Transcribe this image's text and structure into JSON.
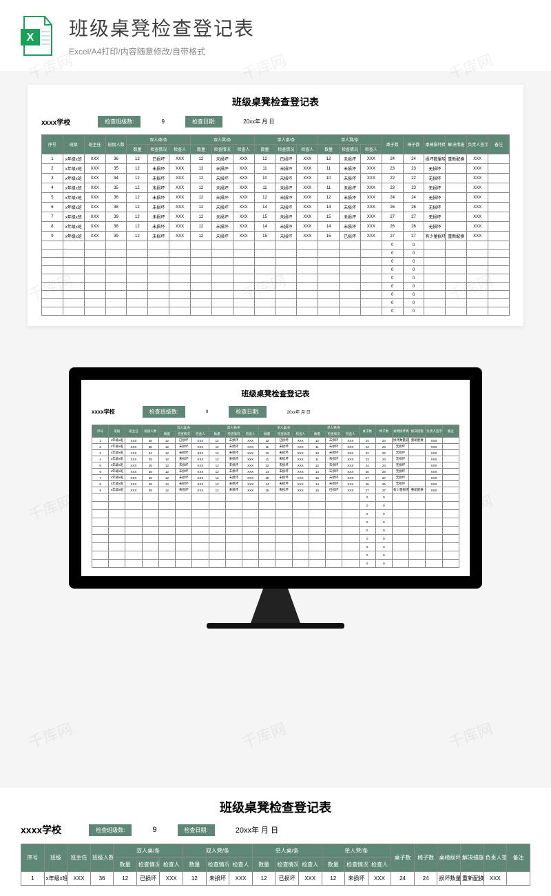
{
  "header": {
    "title": "班级桌凳检查登记表",
    "subtitle": "Excel/A4打印/内容随意修改/自带格式"
  },
  "doc": {
    "title": "班级桌凳检查登记表",
    "school": "xxxx学校",
    "check_class_label": "检查班级数:",
    "check_class_value": "9",
    "check_date_label": "检查日期:",
    "check_date_value": "20xx年 月 日"
  },
  "columns": {
    "seq": "序号",
    "class": "班级",
    "teacher": "班主任",
    "students": "班级人数",
    "g1": "双人桌/条",
    "g2": "双人凳/条",
    "g3": "单人桌/条",
    "g4": "单人凳/条",
    "qty": "数量",
    "status": "检查情况",
    "checker": "检查人",
    "desks": "桌子数",
    "chairs": "椅子数",
    "damage": "桌椅损坏情况",
    "solution": "解决措施",
    "sign": "负责人签字",
    "remark": "备注"
  },
  "rows": [
    {
      "seq": "1",
      "class": "x年级x班",
      "teacher": "XXX",
      "students": "36",
      "q1": "12",
      "s1": "已损坏",
      "c1": "XXX",
      "q2": "12",
      "s2": "未损坏",
      "c2": "XXX",
      "q3": "12",
      "s3": "已损坏",
      "c3": "XXX",
      "q4": "12",
      "s4": "未损坏",
      "c4": "XXX",
      "desks": "24",
      "chairs": "24",
      "damage": "损坏数量较少",
      "solution": "重新配换",
      "sign": "XXX",
      "remark": ""
    },
    {
      "seq": "2",
      "class": "x年级x班",
      "teacher": "XXX",
      "students": "35",
      "q1": "12",
      "s1": "未损坏",
      "c1": "XXX",
      "q2": "12",
      "s2": "未损坏",
      "c2": "XXX",
      "q3": "11",
      "s3": "未损坏",
      "c3": "XXX",
      "q4": "11",
      "s4": "未损坏",
      "c4": "XXX",
      "desks": "23",
      "chairs": "23",
      "damage": "无损坏",
      "solution": "",
      "sign": "XXX",
      "remark": ""
    },
    {
      "seq": "3",
      "class": "x年级x班",
      "teacher": "XXX",
      "students": "34",
      "q1": "12",
      "s1": "未损坏",
      "c1": "XXX",
      "q2": "12",
      "s2": "未损坏",
      "c2": "XXX",
      "q3": "10",
      "s3": "未损坏",
      "c3": "XXX",
      "q4": "10",
      "s4": "未损坏",
      "c4": "XXX",
      "desks": "22",
      "chairs": "22",
      "damage": "无损坏",
      "solution": "",
      "sign": "XXX",
      "remark": ""
    },
    {
      "seq": "4",
      "class": "x年级x班",
      "teacher": "XXX",
      "students": "35",
      "q1": "12",
      "s1": "未损坏",
      "c1": "XXX",
      "q2": "12",
      "s2": "未损坏",
      "c2": "XXX",
      "q3": "11",
      "s3": "未损坏",
      "c3": "XXX",
      "q4": "11",
      "s4": "未损坏",
      "c4": "XXX",
      "desks": "23",
      "chairs": "23",
      "damage": "无损坏",
      "solution": "",
      "sign": "XXX",
      "remark": ""
    },
    {
      "seq": "5",
      "class": "x年级x班",
      "teacher": "XXX",
      "students": "36",
      "q1": "12",
      "s1": "未损坏",
      "c1": "XXX",
      "q2": "12",
      "s2": "未损坏",
      "c2": "XXX",
      "q3": "12",
      "s3": "未损坏",
      "c3": "XXX",
      "q4": "12",
      "s4": "未损坏",
      "c4": "XXX",
      "desks": "24",
      "chairs": "24",
      "damage": "无损坏",
      "solution": "",
      "sign": "XXX",
      "remark": ""
    },
    {
      "seq": "6",
      "class": "x年级x班",
      "teacher": "XXX",
      "students": "38",
      "q1": "12",
      "s1": "未损坏",
      "c1": "XXX",
      "q2": "12",
      "s2": "未损坏",
      "c2": "XXX",
      "q3": "14",
      "s3": "未损坏",
      "c3": "XXX",
      "q4": "14",
      "s4": "未损坏",
      "c4": "XXX",
      "desks": "26",
      "chairs": "26",
      "damage": "无损坏",
      "solution": "",
      "sign": "XXX",
      "remark": ""
    },
    {
      "seq": "7",
      "class": "x年级x班",
      "teacher": "XXX",
      "students": "39",
      "q1": "12",
      "s1": "未损坏",
      "c1": "XXX",
      "q2": "12",
      "s2": "未损坏",
      "c2": "XXX",
      "q3": "15",
      "s3": "未损坏",
      "c3": "XXX",
      "q4": "15",
      "s4": "未损坏",
      "c4": "XXX",
      "desks": "27",
      "chairs": "27",
      "damage": "无损坏",
      "solution": "",
      "sign": "XXX",
      "remark": ""
    },
    {
      "seq": "8",
      "class": "x年级x班",
      "teacher": "XXX",
      "students": "38",
      "q1": "12",
      "s1": "未损坏",
      "c1": "XXX",
      "q2": "12",
      "s2": "未损坏",
      "c2": "XXX",
      "q3": "14",
      "s3": "未损坏",
      "c3": "XXX",
      "q4": "14",
      "s4": "未损坏",
      "c4": "XXX",
      "desks": "26",
      "chairs": "26",
      "damage": "无损坏",
      "solution": "",
      "sign": "XXX",
      "remark": ""
    },
    {
      "seq": "9",
      "class": "x年级x班",
      "teacher": "XXX",
      "students": "39",
      "q1": "12",
      "s1": "未损坏",
      "c1": "XXX",
      "q2": "12",
      "s2": "未损坏",
      "c2": "XXX",
      "q3": "15",
      "s3": "未损坏",
      "c3": "XXX",
      "q4": "15",
      "s4": "已损坏",
      "c4": "XXX",
      "desks": "27",
      "chairs": "27",
      "damage": "有少量损坏",
      "solution": "重新配换",
      "sign": "XXX",
      "remark": ""
    }
  ],
  "zero_rows_count": 9,
  "watermark_text": "千库网"
}
